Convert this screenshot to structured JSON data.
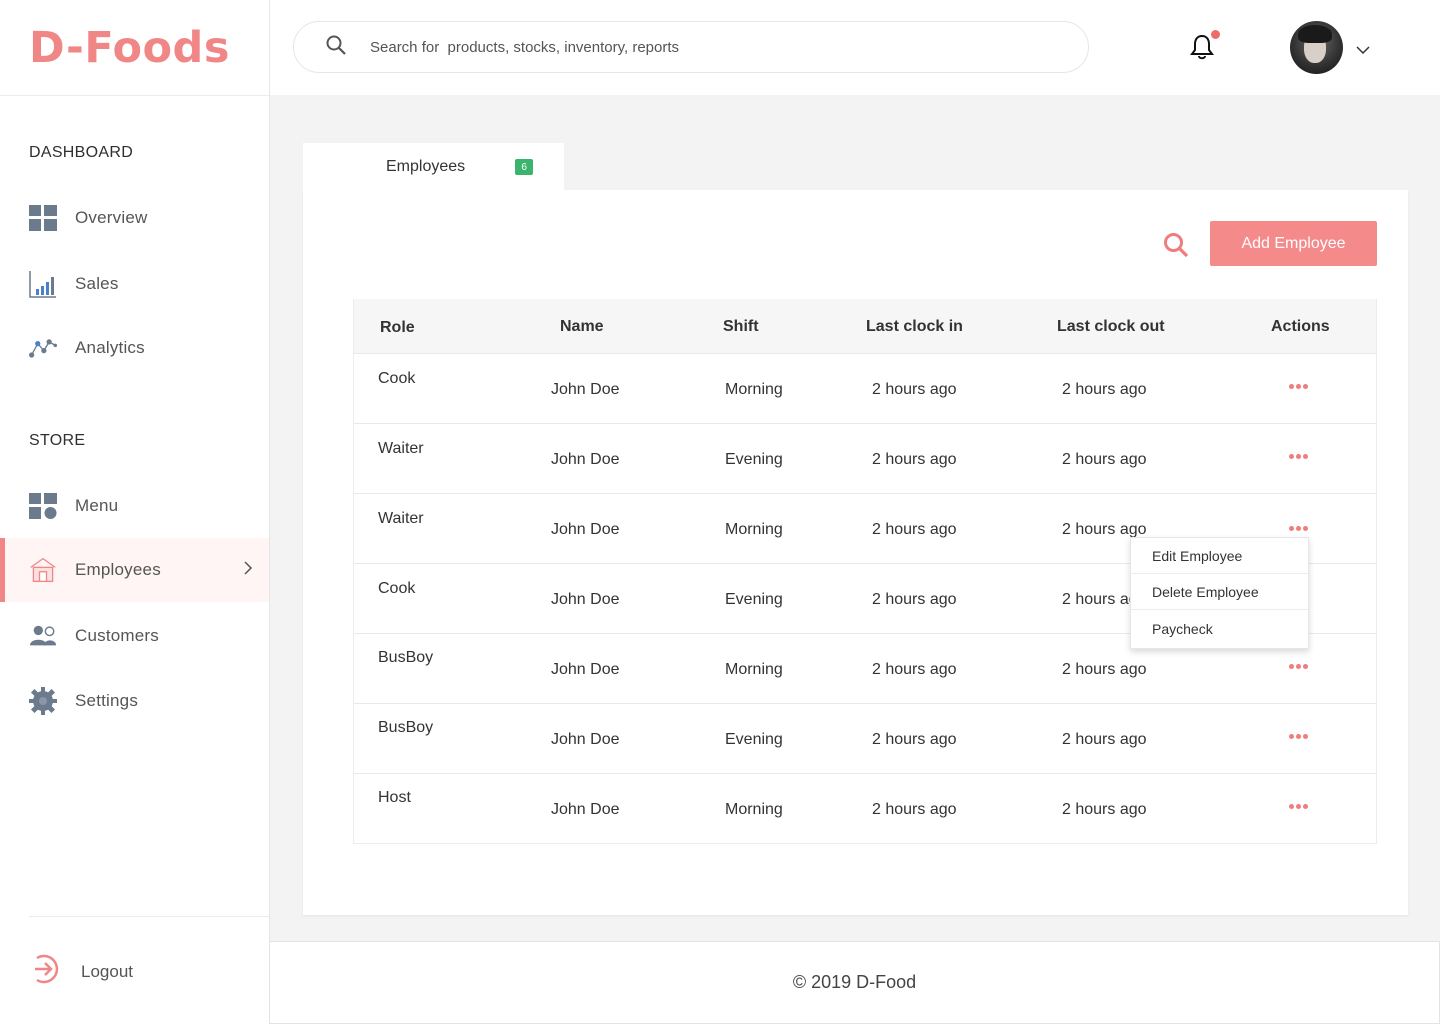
{
  "brand": {
    "logo": "D-Foods",
    "accent": "#f08686"
  },
  "sidebar": {
    "dashboard_title": "DASHBOARD",
    "dashboard_items": [
      {
        "label": "Overview",
        "icon": "grid-icon"
      },
      {
        "label": "Sales",
        "icon": "bar-chart-icon"
      },
      {
        "label": "Analytics",
        "icon": "line-chart-icon"
      }
    ],
    "store_title": "STORE",
    "store_items": [
      {
        "label": "Menu",
        "icon": "menu-grid-icon"
      },
      {
        "label": "Employees",
        "icon": "store-icon",
        "active": true
      },
      {
        "label": "Customers",
        "icon": "users-icon"
      },
      {
        "label": "Settings",
        "icon": "gear-icon"
      }
    ],
    "logout": "Logout"
  },
  "header": {
    "search_placeholder": "Search for  products, stocks, inventory, reports",
    "notification_dot": true
  },
  "tab": {
    "label": "Employees",
    "badge": "6",
    "badge_color": "#3bb56d"
  },
  "toolbar": {
    "add_button": "Add Employee"
  },
  "table": {
    "columns": [
      "Role",
      "Name",
      "Shift",
      "Last clock in",
      "Last clock out",
      "Actions"
    ],
    "rows": [
      {
        "role": "Cook",
        "name": "John Doe",
        "shift": "Morning",
        "clock_in": "2 hours ago",
        "clock_out": "2 hours ago"
      },
      {
        "role": "Waiter",
        "name": "John Doe",
        "shift": "Evening",
        "clock_in": "2 hours ago",
        "clock_out": "2 hours ago"
      },
      {
        "role": "Waiter",
        "name": "John Doe",
        "shift": "Morning",
        "clock_in": "2 hours ago",
        "clock_out": "2 hours ago"
      },
      {
        "role": "Cook",
        "name": "John Doe",
        "shift": "Evening",
        "clock_in": "2 hours ago",
        "clock_out": "2 hours ago"
      },
      {
        "role": "BusBoy",
        "name": "John Doe",
        "shift": "Morning",
        "clock_in": "2 hours ago",
        "clock_out": "2 hours ago"
      },
      {
        "role": "BusBoy",
        "name": "John Doe",
        "shift": "Evening",
        "clock_in": "2 hours ago",
        "clock_out": "2 hours ago"
      },
      {
        "role": "Host",
        "name": "John Doe",
        "shift": "Morning",
        "clock_in": "2 hours ago",
        "clock_out": "2 hours ago"
      }
    ]
  },
  "context_menu": {
    "items": [
      "Edit Employee",
      "Delete Employee",
      "Paycheck"
    ]
  },
  "footer": {
    "text": "© 2019 D-Food"
  }
}
